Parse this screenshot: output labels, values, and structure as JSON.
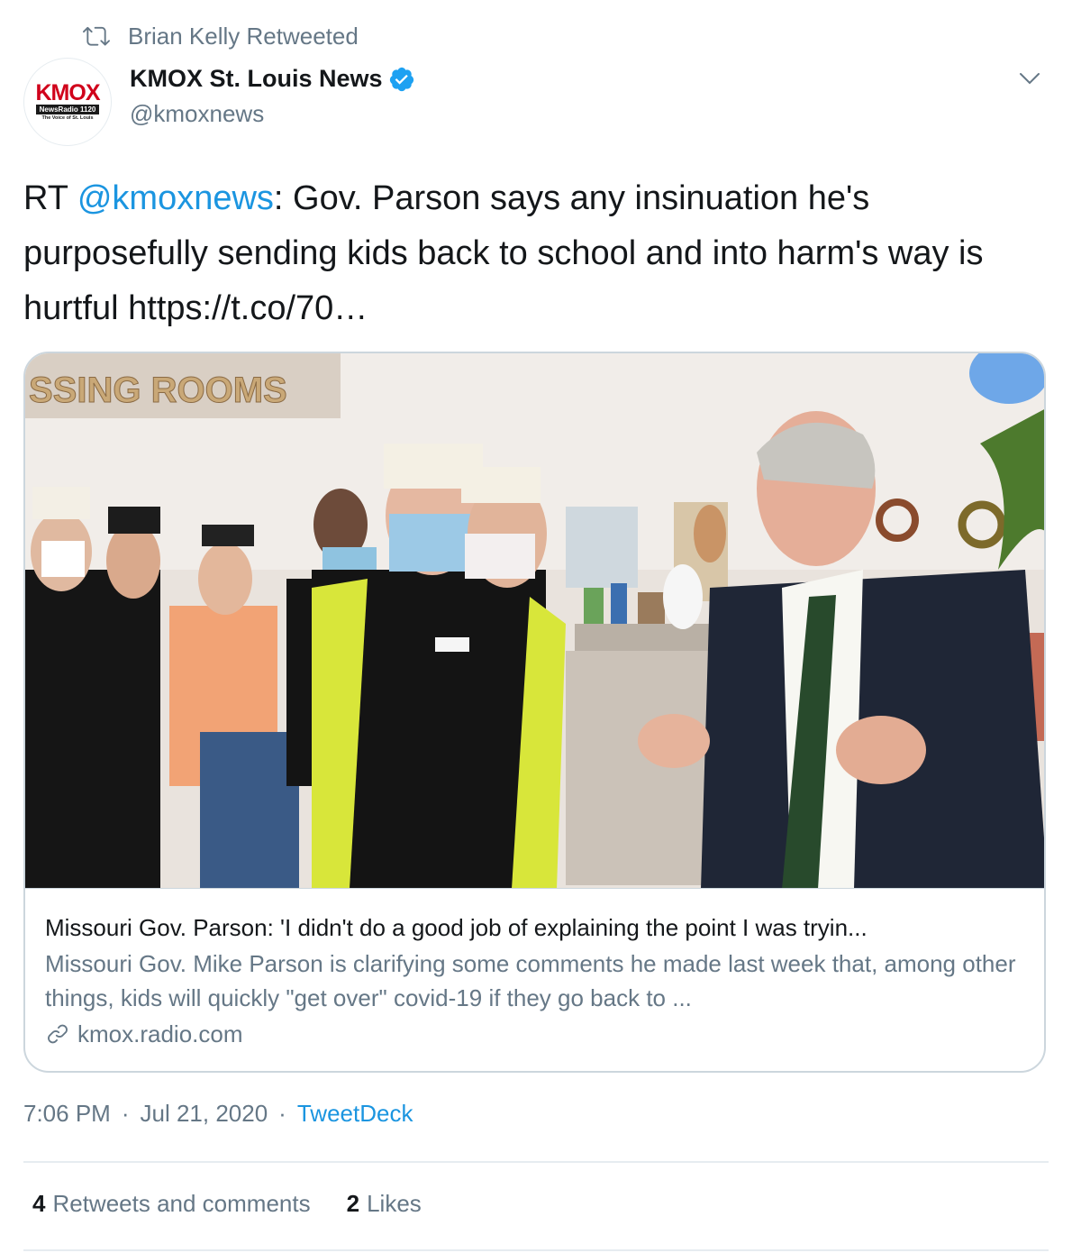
{
  "retweet": {
    "label": "Brian Kelly Retweeted",
    "icon": "retweet-icon"
  },
  "author": {
    "display_name": "KMOX St. Louis News",
    "handle": "@kmoxnews",
    "verified": true,
    "avatar": {
      "logo_text": "KMOX",
      "logo_bar": "NewsRadio 1120",
      "logo_sub": "The Voice of St. Louis"
    }
  },
  "tweet": {
    "prefix": "RT ",
    "mention": "@kmoxnews",
    "body": ": Gov. Parson says any insinuation he's purposefully sending kids back to school and into harm's way is hurtful https://t.co/70…"
  },
  "card": {
    "image_caption_sign": "SSING ROOMS",
    "title": "Missouri Gov. Parson: 'I didn't do a good job of explaining the point I was tryin...",
    "description": "Missouri Gov. Mike Parson is clarifying some comments he made last week that, among other things, kids will quickly \"get over\" covid-19 if they go back to ...",
    "domain": "kmox.radio.com"
  },
  "meta": {
    "time": "7:06 PM",
    "separator": "·",
    "date": "Jul 21, 2020",
    "source": "TweetDeck"
  },
  "stats": {
    "retweets_count": "4",
    "retweets_label": "Retweets and comments",
    "likes_count": "2",
    "likes_label": "Likes"
  },
  "colors": {
    "accent": "#1b95e0",
    "secondary_text": "#657786",
    "border": "#ccd6dd",
    "brand_red": "#d0021b"
  }
}
